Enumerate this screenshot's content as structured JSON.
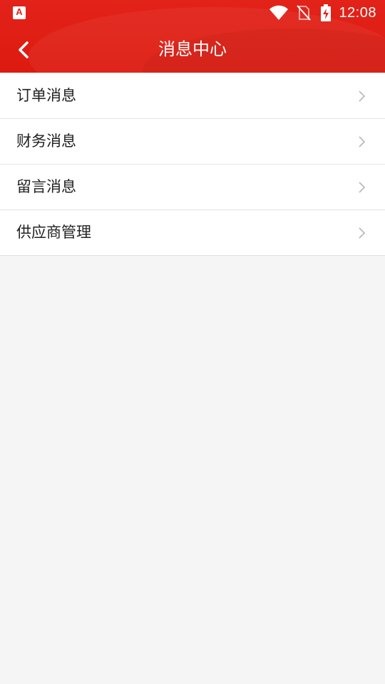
{
  "status_bar": {
    "app_icon_glyph": "A",
    "time": "12:08",
    "icons": [
      "app-notification-icon",
      "wifi-icon",
      "no-sim-icon",
      "battery-charging-icon"
    ]
  },
  "header": {
    "title": "消息中心",
    "back_icon": "chevron-left-icon",
    "background_color": "#e2231a"
  },
  "menu": {
    "items": [
      {
        "label": "订单消息",
        "icon": "chevron-right-icon"
      },
      {
        "label": "财务消息",
        "icon": "chevron-right-icon"
      },
      {
        "label": "留言消息",
        "icon": "chevron-right-icon"
      },
      {
        "label": "供应商管理",
        "icon": "chevron-right-icon"
      }
    ]
  }
}
